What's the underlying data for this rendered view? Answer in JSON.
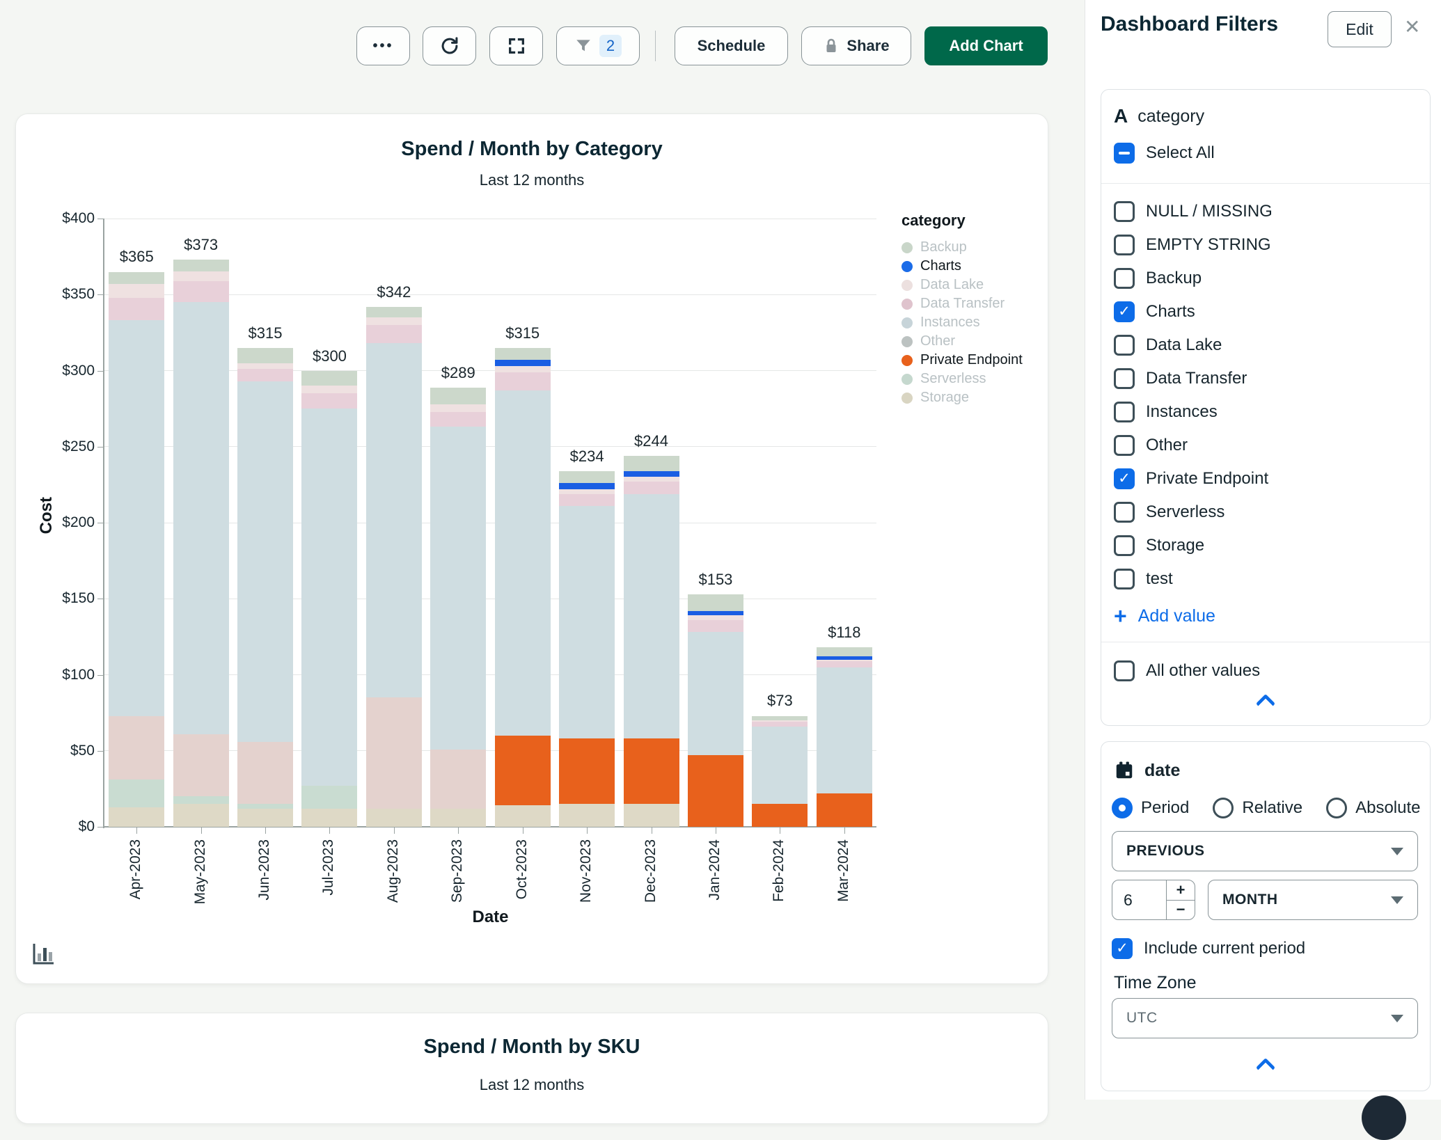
{
  "toolbar": {
    "more_icon_glyph": "•••",
    "filter_count": "2",
    "schedule_label": "Schedule",
    "share_label": "Share",
    "add_chart_label": "Add Chart"
  },
  "second_chart": {
    "title": "Spend / Month by SKU",
    "subtitle": "Last 12 months"
  },
  "sidebar": {
    "title": "Dashboard Filters",
    "edit_label": "Edit",
    "close_icon_glyph": "✕",
    "category_filter": {
      "field_type_glyph": "A",
      "field": "category",
      "select_all_label": "Select All",
      "select_all_state": "indeterminate",
      "items": [
        {
          "label": "NULL / MISSING",
          "checked": false
        },
        {
          "label": "EMPTY STRING",
          "checked": false
        },
        {
          "label": "Backup",
          "checked": false
        },
        {
          "label": "Charts",
          "checked": true
        },
        {
          "label": "Data Lake",
          "checked": false
        },
        {
          "label": "Data Transfer",
          "checked": false
        },
        {
          "label": "Instances",
          "checked": false
        },
        {
          "label": "Other",
          "checked": false
        },
        {
          "label": "Private Endpoint",
          "checked": true
        },
        {
          "label": "Serverless",
          "checked": false
        },
        {
          "label": "Storage",
          "checked": false
        },
        {
          "label": "test",
          "checked": false
        }
      ],
      "add_value_label": "Add value",
      "all_other_values_label": "All other values",
      "all_other_values_checked": false
    },
    "date_filter": {
      "field": "date",
      "modes": [
        "Period",
        "Relative",
        "Absolute"
      ],
      "selected_mode": "Period",
      "operator": "PREVIOUS",
      "amount": "6",
      "unit": "MONTH",
      "include_current_label": "Include current period",
      "include_current_checked": true,
      "timezone_label": "Time Zone",
      "timezone": "UTC"
    }
  },
  "colors": {
    "accent_blue": "#0d6ce8",
    "brand_green": "#00684A",
    "orange": "#e8611c",
    "icon_grey": "#889397"
  },
  "chart_data": {
    "type": "bar",
    "stacked": true,
    "title": "Spend / Month by Category",
    "subtitle": "Last 12 months",
    "xlabel": "Date",
    "ylabel": "Cost",
    "ylim": [
      0,
      400
    ],
    "ytick_step": 50,
    "currency_prefix": "$",
    "grid": true,
    "legend_position": "right",
    "categories": [
      "Apr-2023",
      "May-2023",
      "Jun-2023",
      "Jul-2023",
      "Aug-2023",
      "Sep-2023",
      "Oct-2023",
      "Nov-2023",
      "Dec-2023",
      "Jan-2024",
      "Feb-2024",
      "Mar-2024"
    ],
    "totals": [
      365,
      373,
      315,
      300,
      342,
      289,
      315,
      234,
      244,
      153,
      73,
      118
    ],
    "series": [
      {
        "name": "Storage",
        "color": "#ded9c6",
        "values": [
          13,
          15,
          12,
          12,
          12,
          12,
          14,
          15,
          15,
          0,
          0,
          0
        ]
      },
      {
        "name": "Serverless",
        "color": "#c9dcd1",
        "values": [
          18,
          5,
          3,
          15,
          0,
          0,
          0,
          0,
          0,
          0,
          0,
          0
        ]
      },
      {
        "name": "Private Endpoint",
        "color": "#e8611c",
        "values": [
          0,
          0,
          0,
          0,
          0,
          0,
          46,
          43,
          43,
          47,
          15,
          22
        ]
      },
      {
        "name": "Other",
        "color": "#e4d2ce",
        "values": [
          42,
          41,
          41,
          0,
          73,
          39,
          0,
          0,
          0,
          0,
          0,
          0
        ]
      },
      {
        "name": "Instances",
        "color": "#cfdde1",
        "values": [
          260,
          284,
          237,
          248,
          233,
          212,
          227,
          153,
          161,
          81,
          51,
          83
        ]
      },
      {
        "name": "Data Transfer",
        "color": "#e8d0d9",
        "values": [
          15,
          14,
          8,
          10,
          12,
          10,
          12,
          8,
          8,
          8,
          3,
          4
        ]
      },
      {
        "name": "Data Lake",
        "color": "#efe1e1",
        "values": [
          9,
          6,
          4,
          5,
          5,
          5,
          4,
          3,
          3,
          3,
          1,
          1
        ]
      },
      {
        "name": "Charts",
        "color": "#1a5ee3",
        "values": [
          0,
          0,
          0,
          0,
          0,
          0,
          4,
          4,
          4,
          3,
          0,
          2
        ]
      },
      {
        "name": "Backup",
        "color": "#ccd8cb",
        "values": [
          8,
          8,
          10,
          10,
          7,
          11,
          8,
          8,
          10,
          11,
          3,
          6
        ]
      }
    ],
    "legend": {
      "title": "category",
      "entries": [
        {
          "label": "Backup",
          "color": "#c9d6c9",
          "active": false
        },
        {
          "label": "Charts",
          "color": "#1b6ce8",
          "active": true
        },
        {
          "label": "Data Lake",
          "color": "#ece0df",
          "active": false
        },
        {
          "label": "Data Transfer",
          "color": "#dfc3cd",
          "active": false
        },
        {
          "label": "Instances",
          "color": "#c7d4d9",
          "active": false
        },
        {
          "label": "Other",
          "color": "#bcc2c1",
          "active": false
        },
        {
          "label": "Private Endpoint",
          "color": "#e8611c",
          "active": true
        },
        {
          "label": "Serverless",
          "color": "#c5d8ce",
          "active": false
        },
        {
          "label": "Storage",
          "color": "#d9d5c2",
          "active": false
        }
      ]
    }
  }
}
